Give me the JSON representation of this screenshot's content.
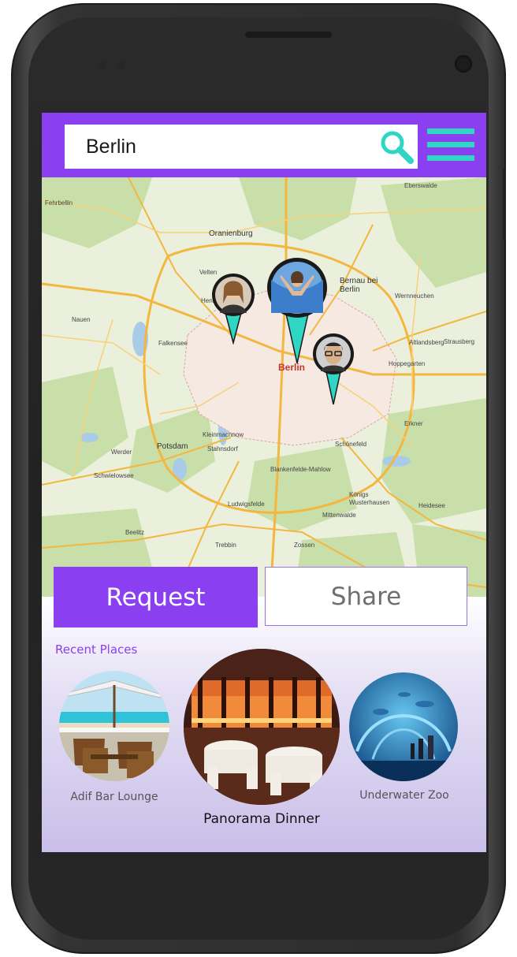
{
  "search": {
    "value": "Berlin"
  },
  "actions": {
    "request_label": "Request",
    "share_label": "Share"
  },
  "recent": {
    "title": "Recent Places",
    "places": [
      {
        "name": "Adif Bar Lounge"
      },
      {
        "name": "Panorama Dinner"
      },
      {
        "name": "Underwater Zoo"
      }
    ]
  },
  "map": {
    "labels": [
      "Eberswalde",
      "Fehrbellin",
      "Oranienburg",
      "Bernau bei Berlin",
      "Nauen",
      "Falkensee",
      "Berlin",
      "Altlandsberg",
      "Potsdam",
      "Werder",
      "Schwielowsee",
      "Kleinmachnow",
      "Schönefeld",
      "Königs Wusterhausen",
      "Beelitz",
      "Trebbin",
      "Zossen",
      "Strausberg",
      "Hoppegarten",
      "Erkner",
      "Ludwigsfelde",
      "Wernneuchen",
      "Velten",
      "Hennigsdorf",
      "Heidesee",
      "Mittenwalde",
      "Stahnsdorf",
      "Blankenfelde-Mahlow"
    ]
  },
  "colors": {
    "accent": "#8a3ff0",
    "teal": "#2fd6c3",
    "map_land": "#eaf0dc",
    "map_forest": "#c9dfa9",
    "map_road": "#f3b63f"
  },
  "icons": [
    "search-icon",
    "menu-icon",
    "map-pin-icon"
  ]
}
